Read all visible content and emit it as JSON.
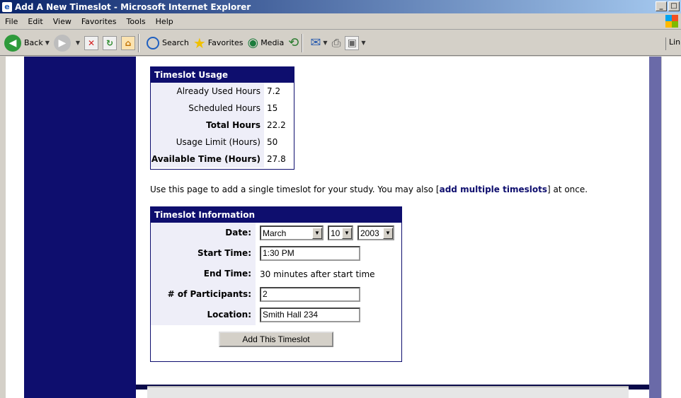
{
  "window": {
    "title": "Add A New Timeslot - Microsoft Internet Explorer",
    "min": "_",
    "max": "□"
  },
  "menu": [
    "File",
    "Edit",
    "View",
    "Favorites",
    "Tools",
    "Help"
  ],
  "toolbar": {
    "back": "Back",
    "search": "Search",
    "favorites": "Favorites",
    "media": "Media",
    "links": "Links"
  },
  "usage": {
    "title": "Timeslot Usage",
    "rows": [
      {
        "label": "Already Used Hours",
        "value": "7.2"
      },
      {
        "label": "Scheduled Hours",
        "value": "15"
      },
      {
        "label": "Total Hours",
        "value": "22.2"
      },
      {
        "label": "Usage Limit (Hours)",
        "value": "50"
      },
      {
        "label": "Available Time (Hours)",
        "value": "27.8"
      }
    ]
  },
  "intro": {
    "before": "Use this page to add a single timeslot for your study. You may also [",
    "link": "add multiple timeslots",
    "after": "] at once."
  },
  "info": {
    "title": "Timeslot Information",
    "date_label": "Date:",
    "month": "March",
    "day": "10",
    "year": "2003",
    "start_label": "Start Time:",
    "start_value": "1:30 PM",
    "end_label": "End Time:",
    "end_value": "30 minutes after start time",
    "participants_label": "# of Participants:",
    "participants_value": "2",
    "location_label": "Location:",
    "location_value": "Smith Hall 234",
    "submit": "Add This Timeslot"
  }
}
